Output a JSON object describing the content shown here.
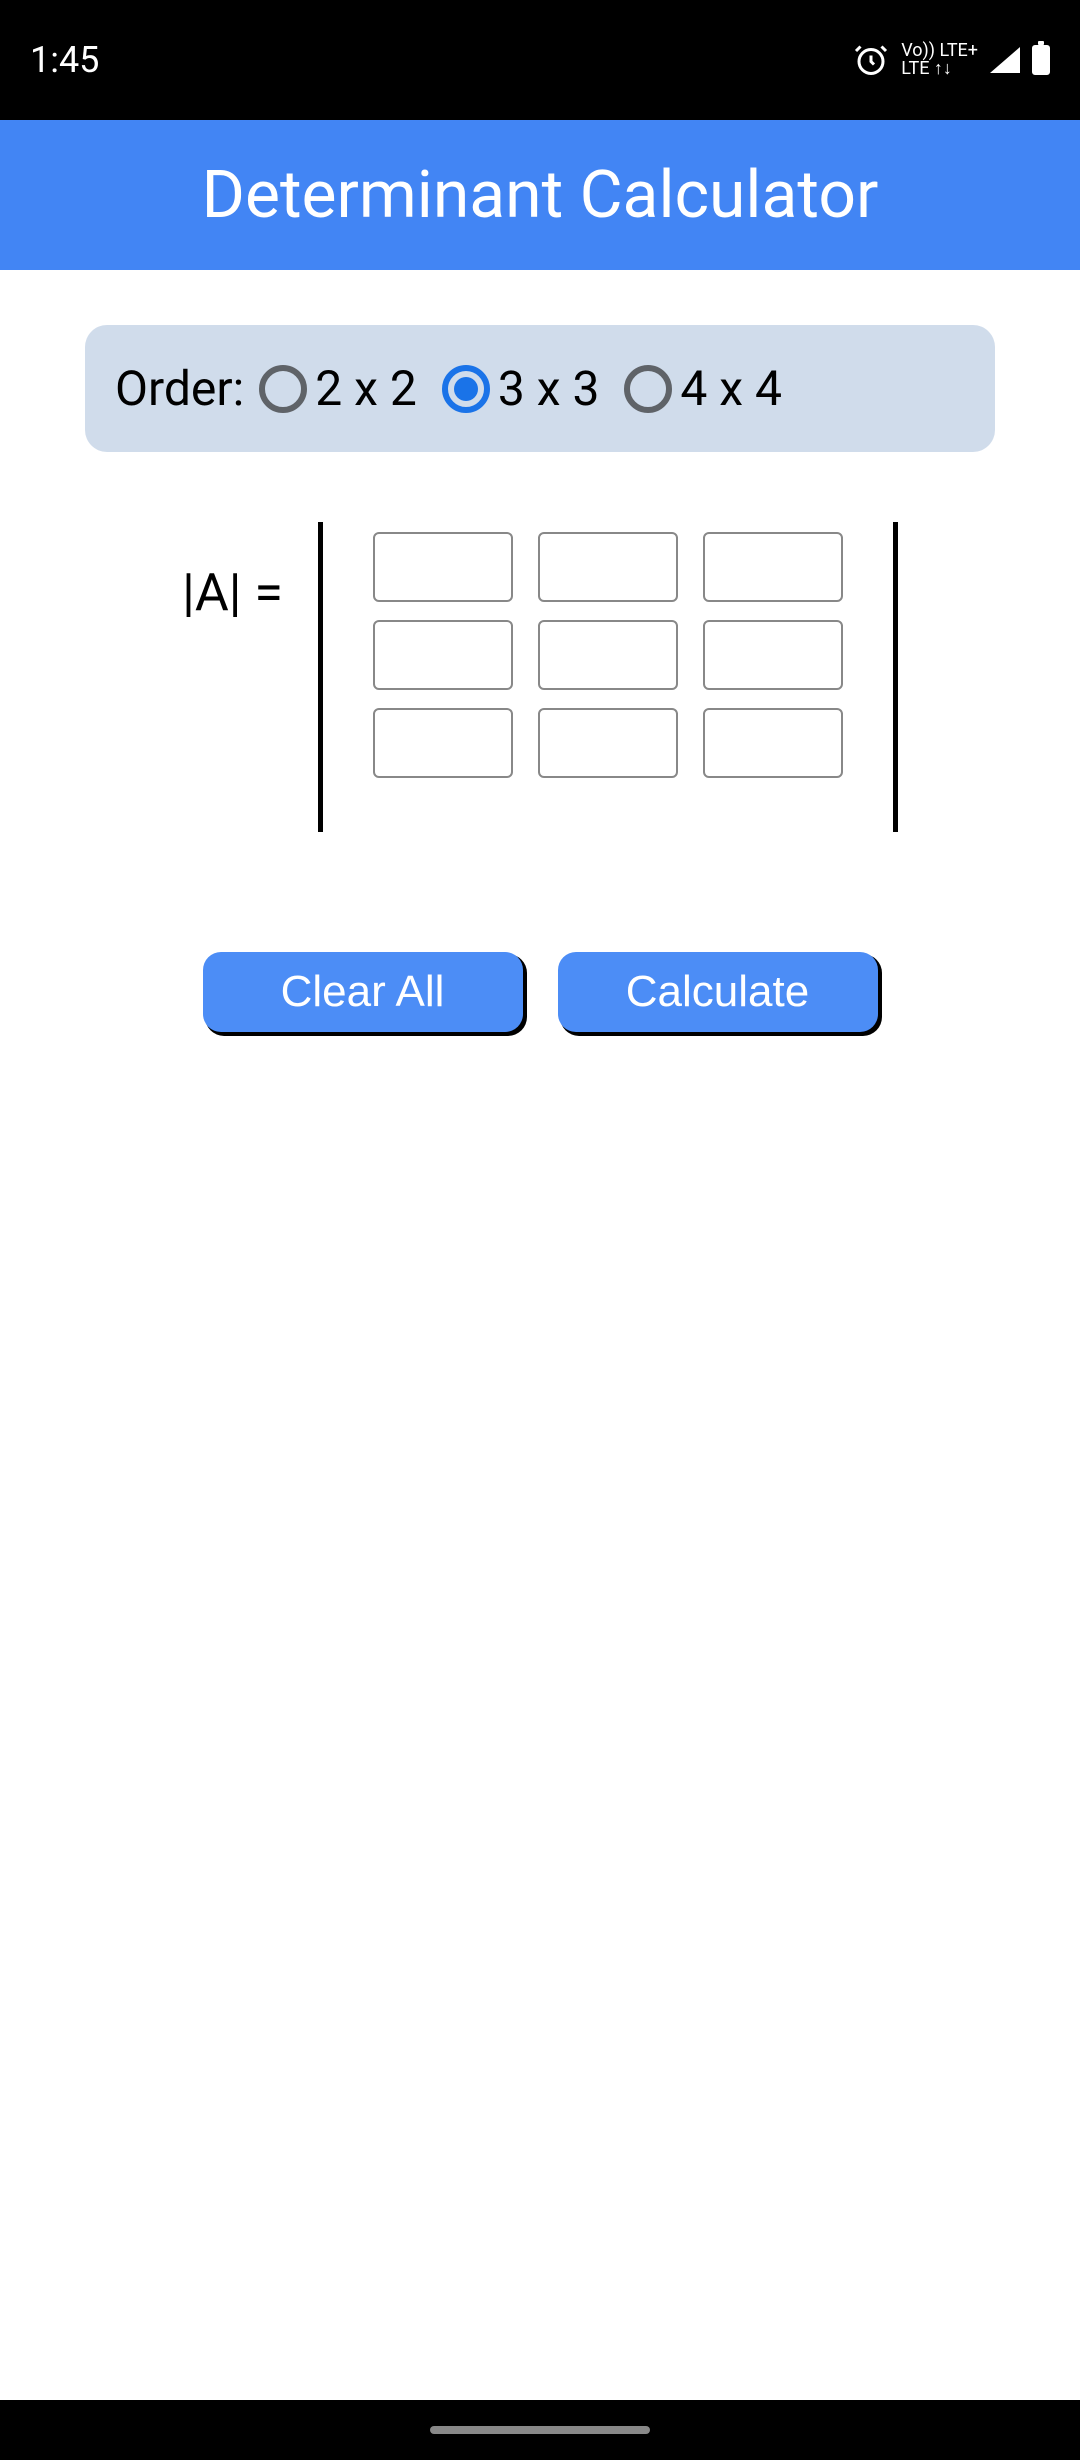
{
  "status": {
    "time": "1:45",
    "network_top": "Vo)) LTE+",
    "network_bottom": "LTE  ↑↓"
  },
  "app": {
    "title": "Determinant Calculator"
  },
  "order": {
    "label": "Order:",
    "options": {
      "o2": "2 x 2",
      "o3": "3 x 3",
      "o4": "4 x 4"
    },
    "selected": "3 x 3"
  },
  "matrix": {
    "label": "|A| ="
  },
  "buttons": {
    "clear": "Clear All",
    "calculate": "Calculate"
  }
}
